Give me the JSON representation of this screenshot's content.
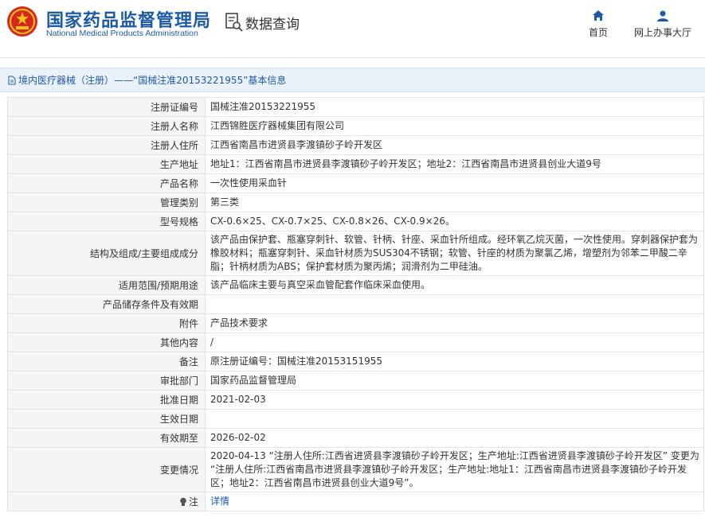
{
  "header": {
    "title_cn": "国家药品监督管理局",
    "title_en": "National Medical Products Administration",
    "query_label": "数据查询",
    "nav": {
      "home": "首页",
      "hall": "网上办事大厅"
    }
  },
  "breadcrumb": "境内医疗器械（注册）——“国械注准20153221955”基本信息",
  "rows": [
    {
      "label": "注册证编号",
      "value": "国械注准20153221955",
      "h": 24
    },
    {
      "label": "注册人名称",
      "value": "江西锦胜医疗器械集团有限公司",
      "h": 24
    },
    {
      "label": "注册人住所",
      "value": "江西省南昌市进贤县李渡镇砂子岭开发区",
      "h": 24
    },
    {
      "label": "生产地址",
      "value": "地址1：江西省南昌市进贤县李渡镇砂子岭开发区；地址2：江西省南昌市进贤县创业大道9号",
      "h": 24
    },
    {
      "label": "产品名称",
      "value": "一次性使用采血针",
      "h": 24
    },
    {
      "label": "管理类别",
      "value": "第三类",
      "h": 24
    },
    {
      "label": "型号规格",
      "value": "CX-0.6×25、CX-0.7×25、CX-0.8×26、CX-0.9×26。",
      "h": 24
    },
    {
      "label": "结构及组成/主要组成成分",
      "value": "该产品由保护套、瓶塞穿刺针、软管、针柄、针座、采血针所组成。经环氧乙烷灭菌，一次性使用。穿刺器保护套为橡胶材料；瓶塞穿刺针、采血针材质为SUS304不锈钢；软管、针座的材质为聚氯乙烯，增塑剂为邻苯二甲酸二辛脂；针柄材质为ABS；保护套材质为聚丙烯；润滑剂为二甲硅油。",
      "h": 56
    },
    {
      "label": "适用范围/预期用途",
      "value": "该产品临床主要与真空采血管配套作临床采血使用。",
      "h": 24
    },
    {
      "label": "产品储存条件及有效期",
      "value": "",
      "h": 24
    },
    {
      "label": "附件",
      "value": "产品技术要求",
      "h": 24
    },
    {
      "label": "其他内容",
      "value": "/",
      "h": 24
    },
    {
      "label": "备注",
      "value": "原注册证编号：国械注准20153151955",
      "h": 24
    },
    {
      "label": "审批部门",
      "value": "国家药品监督管理局",
      "h": 24
    },
    {
      "label": "批准日期",
      "value": "2021-02-03",
      "h": 24
    },
    {
      "label": "生效日期",
      "value": "",
      "h": 24
    },
    {
      "label": "有效期至",
      "value": "2026-02-02",
      "h": 24
    },
    {
      "label": "变更情况",
      "value": "2020-04-13 “注册人住所:江西省进贤县李渡镇砂子岭开发区；生产地址:江西省进贤县李渡镇砂子岭开发区” 变更为 “注册人住所:江西省南昌市进贤县李渡镇砂子岭开发区；生产地址:地址1：江西省南昌市进贤县李渡镇砂子岭开发区；地址2：江西省南昌市进贤县创业大道9号”。",
      "h": 56
    }
  ],
  "note": {
    "label": "注",
    "link": "详情",
    "h": 24
  }
}
